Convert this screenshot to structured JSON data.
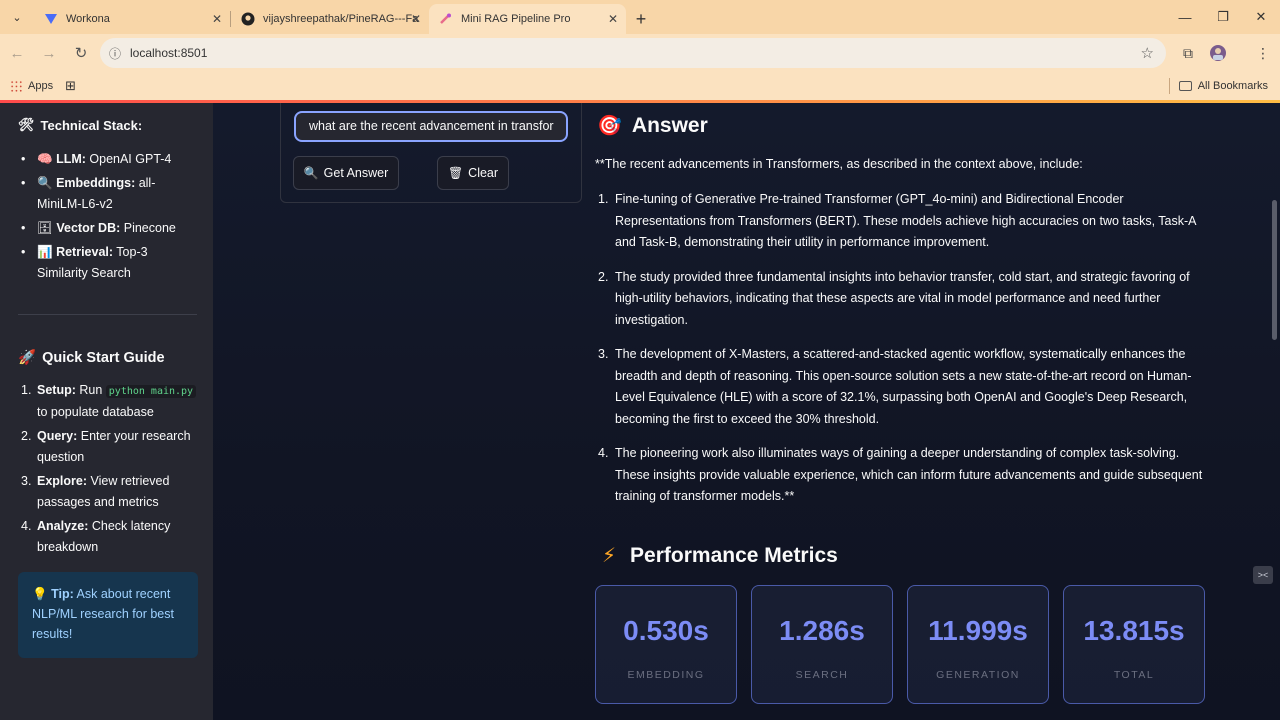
{
  "browser": {
    "tabs": [
      {
        "title": "Workona",
        "icon": "workona-icon"
      },
      {
        "title": "vijayshreepathak/PineRAG---Fa",
        "icon": "github-icon"
      },
      {
        "title": "Mini RAG Pipeline Pro",
        "icon": "streamlit-icon",
        "active": true
      }
    ],
    "url": "localhost:8501",
    "bookmarks": {
      "apps_label": "Apps",
      "all_bookmarks_label": "All Bookmarks"
    }
  },
  "sidebar": {
    "stack_title": "Technical Stack:",
    "stack_items": [
      {
        "icon": "🧠",
        "key": "LLM:",
        "value": " OpenAI GPT-4"
      },
      {
        "icon": "🔍",
        "key": "Embeddings:",
        "value": " all-MiniLM-L6-v2"
      },
      {
        "icon": "🗄",
        "key": "Vector DB:",
        "value": " Pinecone"
      },
      {
        "icon": "📊",
        "key": "Retrieval:",
        "value": " Top-3 Similarity Search"
      }
    ],
    "guide_title": "Quick Start Guide",
    "guide_steps": [
      {
        "key": "Setup:",
        "pre": " Run ",
        "code": "python main.py",
        "post": " to populate database"
      },
      {
        "key": "Query:",
        "pre": " Enter your research question",
        "code": "",
        "post": ""
      },
      {
        "key": "Explore:",
        "pre": " View retrieved passages and metrics",
        "code": "",
        "post": ""
      },
      {
        "key": "Analyze:",
        "pre": " Check latency breakdown",
        "code": "",
        "post": ""
      }
    ],
    "tip_key": "Tip:",
    "tip_text": " Ask about recent NLP/ML research for best results!"
  },
  "query": {
    "value": "what are the recent advancement in transfor",
    "get_answer_label": "Get Answer",
    "clear_label": "Clear"
  },
  "answer": {
    "title": "Answer",
    "intro": "**The recent advancements in Transformers, as described in the context above, include:",
    "items": [
      "Fine-tuning of Generative Pre-trained Transformer (GPT_4o-mini) and Bidirectional Encoder Representations from Transformers (BERT). These models achieve high accuracies on two tasks, Task-A and Task-B, demonstrating their utility in performance improvement.",
      "The study provided three fundamental insights into behavior transfer, cold start, and strategic favoring of high-utility behaviors, indicating that these aspects are vital in model performance and need further investigation.",
      "The development of X-Masters, a scattered-and-stacked agentic workflow, systematically enhances the breadth and depth of reasoning. This open-source solution sets a new state-of-the-art record on Human-Level Equivalence (HLE) with a score of 32.1%, surpassing both OpenAI and Google's Deep Research, becoming the first to exceed the 30% threshold.",
      "The pioneering work also illuminates ways of gaining a deeper understanding of complex task-solving. These insights provide valuable experience, which can inform future advancements and guide subsequent training of transformer models.**"
    ]
  },
  "performance": {
    "title": "Performance Metrics",
    "metrics": [
      {
        "value": "0.530s",
        "label": "EMBEDDING"
      },
      {
        "value": "1.286s",
        "label": "SEARCH"
      },
      {
        "value": "11.999s",
        "label": "GENERATION"
      },
      {
        "value": "13.815s",
        "label": "TOTAL"
      }
    ]
  },
  "colors": {
    "accent": "#7c8cf5",
    "sidebar_bg": "#262730",
    "tip_bg": "#16354e"
  }
}
